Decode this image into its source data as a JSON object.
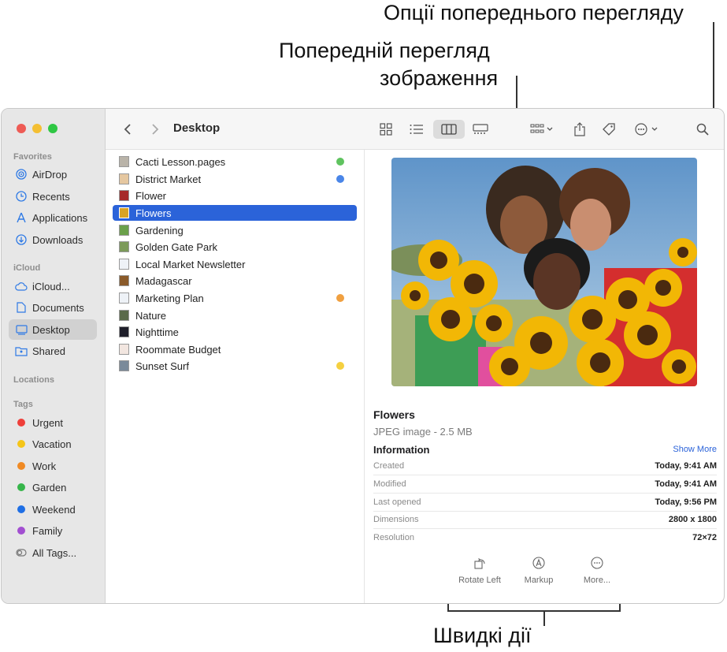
{
  "callouts": {
    "preview_options": "Опції попереднього перегляду",
    "image_preview_line1": "Попередній перегляд",
    "image_preview_line2": "зображення",
    "quick_actions": "Швидкі дії"
  },
  "window": {
    "folder_title": "Desktop"
  },
  "sidebar": {
    "favorites_header": "Favorites",
    "favorites": [
      {
        "label": "AirDrop",
        "icon": "airdrop-icon"
      },
      {
        "label": "Recents",
        "icon": "clock-icon"
      },
      {
        "label": "Applications",
        "icon": "applications-icon"
      },
      {
        "label": "Downloads",
        "icon": "download-icon"
      }
    ],
    "icloud_header": "iCloud",
    "icloud": [
      {
        "label": "iCloud...",
        "icon": "cloud-icon"
      },
      {
        "label": "Documents",
        "icon": "document-icon"
      },
      {
        "label": "Desktop",
        "icon": "desktop-icon",
        "selected": true
      },
      {
        "label": "Shared",
        "icon": "shared-folder-icon"
      }
    ],
    "locations_header": "Locations",
    "tags_header": "Tags",
    "tags": [
      {
        "label": "Urgent",
        "color": "#ef3f3a"
      },
      {
        "label": "Vacation",
        "color": "#f5c518"
      },
      {
        "label": "Work",
        "color": "#f08a24"
      },
      {
        "label": "Garden",
        "color": "#36b54a"
      },
      {
        "label": "Weekend",
        "color": "#1f6fe5"
      },
      {
        "label": "Family",
        "color": "#a24fd1"
      }
    ],
    "all_tags": "All Tags..."
  },
  "files": [
    {
      "name": "Cacti Lesson.pages",
      "dot": "#5fc35f"
    },
    {
      "name": "District Market",
      "dot": "#4a86e8"
    },
    {
      "name": "Flower",
      "dot": null
    },
    {
      "name": "Flowers",
      "dot": null,
      "selected": true
    },
    {
      "name": "Gardening",
      "dot": null
    },
    {
      "name": "Golden Gate Park",
      "dot": null
    },
    {
      "name": "Local Market Newsletter",
      "dot": null
    },
    {
      "name": "Madagascar",
      "dot": null
    },
    {
      "name": "Marketing Plan",
      "dot": "#f0a040"
    },
    {
      "name": "Nature",
      "dot": null
    },
    {
      "name": "Nighttime",
      "dot": null
    },
    {
      "name": "Roommate Budget",
      "dot": null
    },
    {
      "name": "Sunset Surf",
      "dot": "#f5d040"
    }
  ],
  "preview": {
    "title": "Flowers",
    "subtitle": "JPEG image - 2.5 MB",
    "info_header": "Information",
    "show_more": "Show More",
    "info": [
      {
        "key": "Created",
        "value": "Today, 9:41 AM"
      },
      {
        "key": "Modified",
        "value": "Today, 9:41 AM"
      },
      {
        "key": "Last opened",
        "value": "Today, 9:56 PM"
      },
      {
        "key": "Dimensions",
        "value": "2800 x 1800"
      },
      {
        "key": "Resolution",
        "value": "72×72"
      }
    ],
    "quick_actions": [
      {
        "label": "Rotate Left",
        "icon": "rotate-left-icon"
      },
      {
        "label": "Markup",
        "icon": "markup-icon"
      },
      {
        "label": "More...",
        "icon": "more-icon"
      }
    ]
  }
}
